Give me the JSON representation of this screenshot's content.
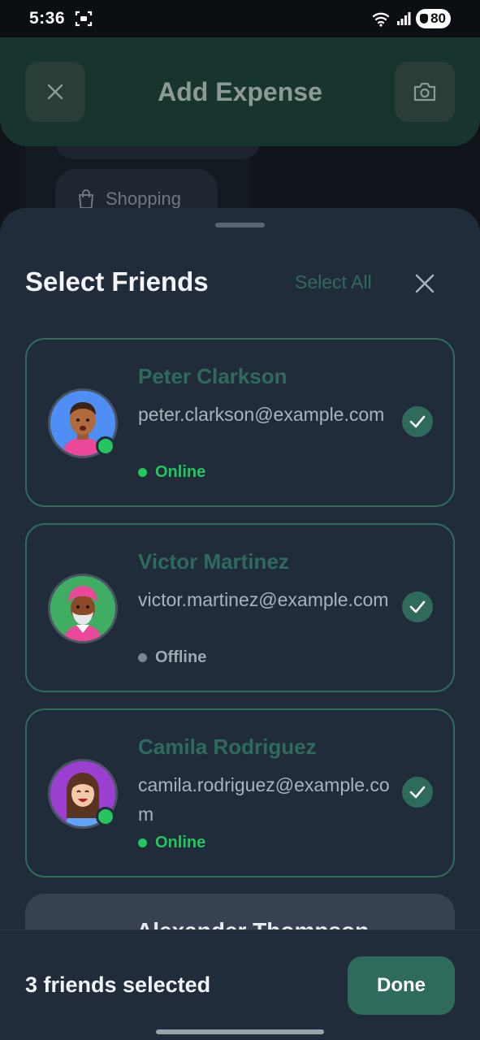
{
  "status_bar": {
    "time": "5:36",
    "battery": "80"
  },
  "background": {
    "header_title": "Add Expense",
    "chip_label": "Shopping"
  },
  "sheet": {
    "title": "Select Friends",
    "select_all_label": "Select All",
    "friends": [
      {
        "name": "Peter Clarkson",
        "email": "peter.clarkson@example.com",
        "status": "Online",
        "online": true,
        "selected": true
      },
      {
        "name": "Victor Martinez",
        "email": "victor.martinez@example.com",
        "status": "Offline",
        "online": false,
        "selected": true
      },
      {
        "name": "Camila Rodriguez",
        "email": "camila.rodriguez@example.com",
        "status": "Online",
        "online": true,
        "selected": true
      },
      {
        "name": "Alexander Thompson"
      }
    ]
  },
  "footer": {
    "selected_count": "3 friends selected",
    "done_label": "Done"
  },
  "colors": {
    "accent": "#2f6b5c",
    "online": "#22c55e",
    "sheet_bg": "#212c3a"
  }
}
